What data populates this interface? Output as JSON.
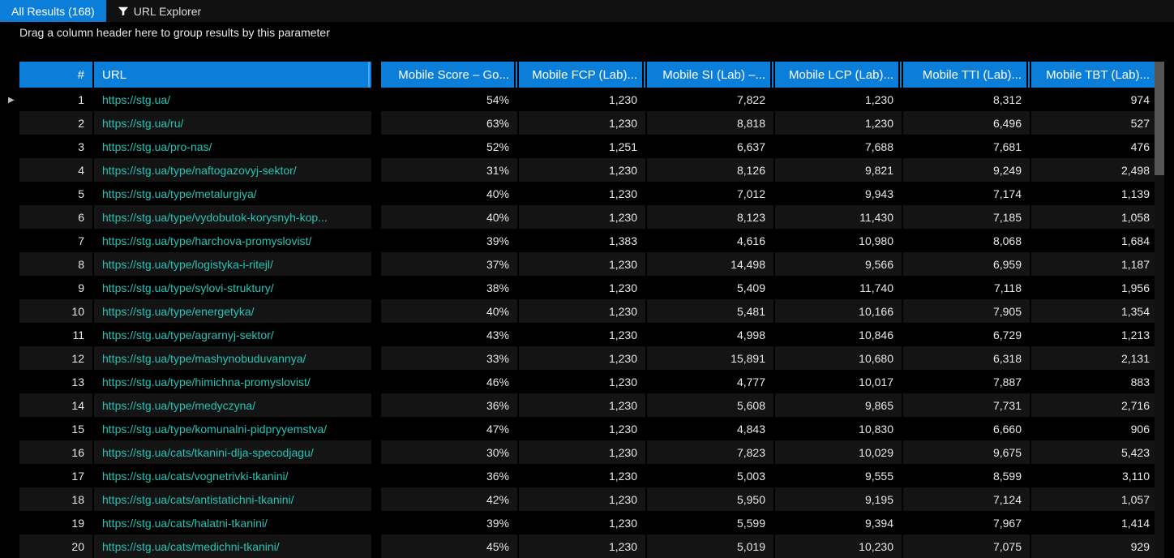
{
  "tabs": {
    "all_results": "All Results (168)",
    "url_explorer": "URL Explorer"
  },
  "group_hint": "Drag a column header here to group results by this parameter",
  "columns": {
    "idx": "#",
    "url": "URL",
    "score": "Mobile Score  –  Go...",
    "fcp": "Mobile FCP (Lab)...",
    "si": "Mobile SI (Lab)  –...",
    "lcp": "Mobile LCP (Lab)...",
    "tti": "Mobile TTI (Lab)...",
    "tbt": "Mobile TBT (Lab)..."
  },
  "rows": [
    {
      "n": 1,
      "url": "https://stg.ua/",
      "score": "54%",
      "fcp": "1,230",
      "si": "7,822",
      "lcp": "1,230",
      "tti": "8,312",
      "tbt": "974"
    },
    {
      "n": 2,
      "url": "https://stg.ua/ru/",
      "score": "63%",
      "fcp": "1,230",
      "si": "8,818",
      "lcp": "1,230",
      "tti": "6,496",
      "tbt": "527"
    },
    {
      "n": 3,
      "url": "https://stg.ua/pro-nas/",
      "score": "52%",
      "fcp": "1,251",
      "si": "6,637",
      "lcp": "7,688",
      "tti": "7,681",
      "tbt": "476"
    },
    {
      "n": 4,
      "url": "https://stg.ua/type/naftogazovyj-sektor/",
      "score": "31%",
      "fcp": "1,230",
      "si": "8,126",
      "lcp": "9,821",
      "tti": "9,249",
      "tbt": "2,498"
    },
    {
      "n": 5,
      "url": "https://stg.ua/type/metalurgiya/",
      "score": "40%",
      "fcp": "1,230",
      "si": "7,012",
      "lcp": "9,943",
      "tti": "7,174",
      "tbt": "1,139"
    },
    {
      "n": 6,
      "url": "https://stg.ua/type/vydobutok-korysnyh-kop...",
      "score": "40%",
      "fcp": "1,230",
      "si": "8,123",
      "lcp": "11,430",
      "tti": "7,185",
      "tbt": "1,058"
    },
    {
      "n": 7,
      "url": "https://stg.ua/type/harchova-promyslovist/",
      "score": "39%",
      "fcp": "1,383",
      "si": "4,616",
      "lcp": "10,980",
      "tti": "8,068",
      "tbt": "1,684"
    },
    {
      "n": 8,
      "url": "https://stg.ua/type/logistyka-i-ritejl/",
      "score": "37%",
      "fcp": "1,230",
      "si": "14,498",
      "lcp": "9,566",
      "tti": "6,959",
      "tbt": "1,187"
    },
    {
      "n": 9,
      "url": "https://stg.ua/type/sylovi-struktury/",
      "score": "38%",
      "fcp": "1,230",
      "si": "5,409",
      "lcp": "11,740",
      "tti": "7,118",
      "tbt": "1,956"
    },
    {
      "n": 10,
      "url": "https://stg.ua/type/energetyka/",
      "score": "40%",
      "fcp": "1,230",
      "si": "5,481",
      "lcp": "10,166",
      "tti": "7,905",
      "tbt": "1,354"
    },
    {
      "n": 11,
      "url": "https://stg.ua/type/agrarnyj-sektor/",
      "score": "43%",
      "fcp": "1,230",
      "si": "4,998",
      "lcp": "10,846",
      "tti": "6,729",
      "tbt": "1,213"
    },
    {
      "n": 12,
      "url": "https://stg.ua/type/mashynobuduvannya/",
      "score": "33%",
      "fcp": "1,230",
      "si": "15,891",
      "lcp": "10,680",
      "tti": "6,318",
      "tbt": "2,131"
    },
    {
      "n": 13,
      "url": "https://stg.ua/type/himichna-promyslovist/",
      "score": "46%",
      "fcp": "1,230",
      "si": "4,777",
      "lcp": "10,017",
      "tti": "7,887",
      "tbt": "883"
    },
    {
      "n": 14,
      "url": "https://stg.ua/type/medyczyna/",
      "score": "36%",
      "fcp": "1,230",
      "si": "5,608",
      "lcp": "9,865",
      "tti": "7,731",
      "tbt": "2,716"
    },
    {
      "n": 15,
      "url": "https://stg.ua/type/komunalni-pidpryyemstva/",
      "score": "47%",
      "fcp": "1,230",
      "si": "4,843",
      "lcp": "10,830",
      "tti": "6,660",
      "tbt": "906"
    },
    {
      "n": 16,
      "url": "https://stg.ua/cats/tkanini-dlja-specodjagu/",
      "score": "30%",
      "fcp": "1,230",
      "si": "7,823",
      "lcp": "10,029",
      "tti": "9,675",
      "tbt": "5,423"
    },
    {
      "n": 17,
      "url": "https://stg.ua/cats/vognetrivki-tkanini/",
      "score": "36%",
      "fcp": "1,230",
      "si": "5,003",
      "lcp": "9,555",
      "tti": "8,599",
      "tbt": "3,110"
    },
    {
      "n": 18,
      "url": "https://stg.ua/cats/antistatichni-tkanini/",
      "score": "42%",
      "fcp": "1,230",
      "si": "5,950",
      "lcp": "9,195",
      "tti": "7,124",
      "tbt": "1,057"
    },
    {
      "n": 19,
      "url": "https://stg.ua/cats/halatni-tkanini/",
      "score": "39%",
      "fcp": "1,230",
      "si": "5,599",
      "lcp": "9,394",
      "tti": "7,967",
      "tbt": "1,414"
    },
    {
      "n": 20,
      "url": "https://stg.ua/cats/medichni-tkanini/",
      "score": "45%",
      "fcp": "1,230",
      "si": "5,019",
      "lcp": "10,230",
      "tti": "7,075",
      "tbt": "929"
    }
  ]
}
